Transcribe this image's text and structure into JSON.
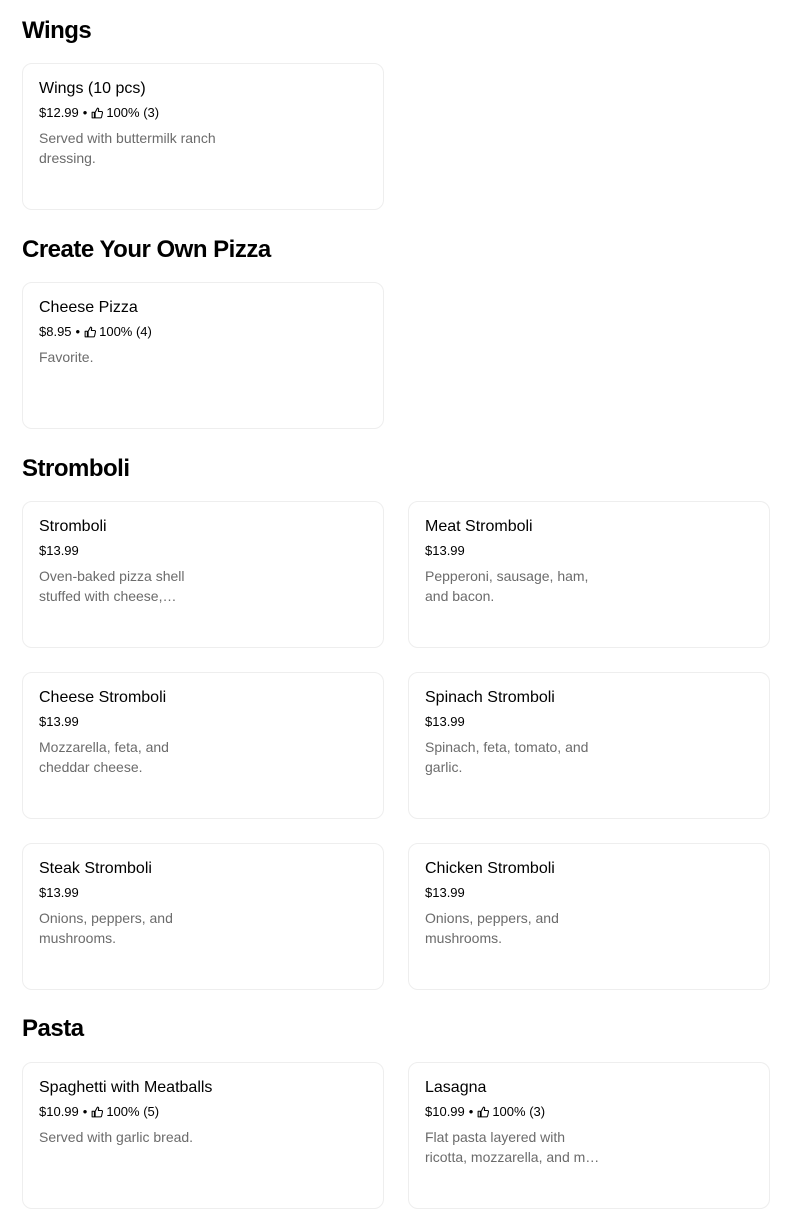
{
  "sections": [
    {
      "title": "Wings",
      "items": [
        {
          "name": "Wings (10 pcs)",
          "price": "$12.99",
          "rating": "100% (3)",
          "description": "Served with buttermilk ranch dressing."
        }
      ]
    },
    {
      "title": "Create Your Own Pizza",
      "items": [
        {
          "name": "Cheese Pizza",
          "price": "$8.95",
          "rating": "100% (4)",
          "description": "Favorite."
        }
      ]
    },
    {
      "title": "Stromboli",
      "items": [
        {
          "name": "Stromboli",
          "price": "$13.99",
          "description": "Oven-baked pizza shell stuffed with cheese, pepperoni, and sausage."
        },
        {
          "name": "Meat Stromboli",
          "price": "$13.99",
          "description": "Pepperoni, sausage, ham, and bacon."
        },
        {
          "name": "Cheese Stromboli",
          "price": "$13.99",
          "description": "Mozzarella, feta, and cheddar cheese."
        },
        {
          "name": "Spinach Stromboli",
          "price": "$13.99",
          "description": "Spinach, feta, tomato, and garlic."
        },
        {
          "name": "Steak Stromboli",
          "price": "$13.99",
          "description": "Onions, peppers, and mushrooms."
        },
        {
          "name": "Chicken Stromboli",
          "price": "$13.99",
          "description": "Onions, peppers, and mushrooms."
        }
      ]
    },
    {
      "title": "Pasta",
      "items": [
        {
          "name": "Spaghetti with Meatballs",
          "price": "$10.99",
          "rating": "100% (5)",
          "description": "Served with garlic bread."
        },
        {
          "name": "Lasagna",
          "price": "$10.99",
          "rating": "100% (3)",
          "description": "Flat pasta layered with ricotta, mozzarella, and meat sauce."
        }
      ]
    }
  ],
  "separator": "•",
  "icons": {
    "rating": "thumbs-up-icon"
  }
}
